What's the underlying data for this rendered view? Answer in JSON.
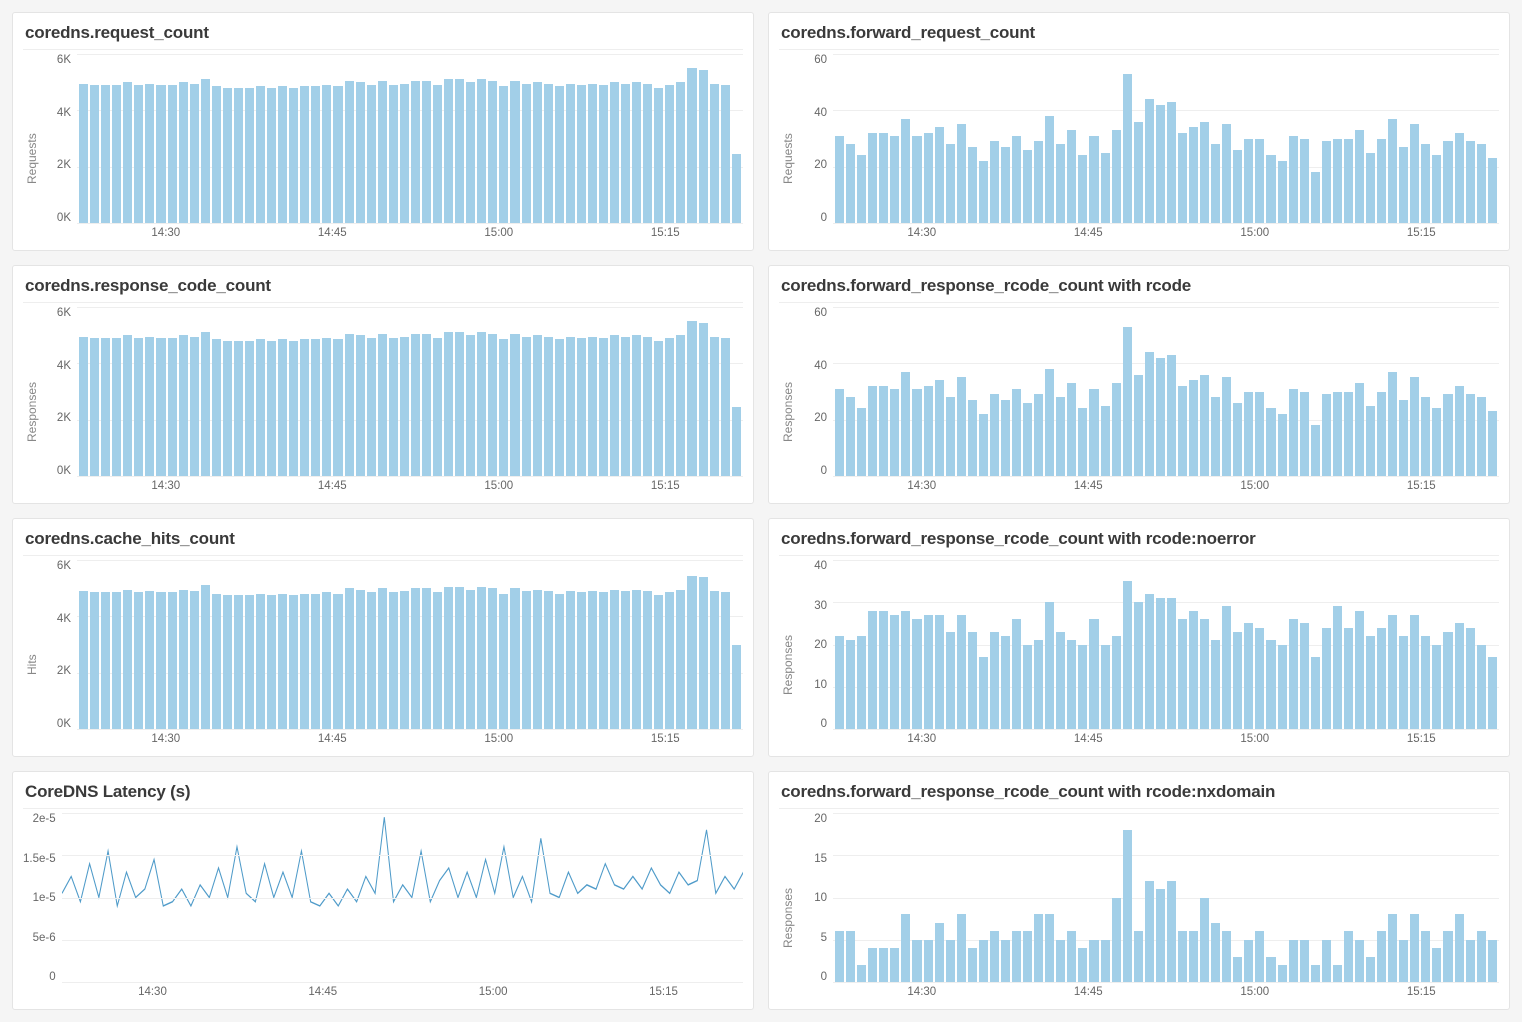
{
  "x_labels": [
    "14:30",
    "14:45",
    "15:00",
    "15:15"
  ],
  "panels": [
    {
      "id": "request_count",
      "title": "coredns.request_count",
      "ylabel": "Requests",
      "type": "bar",
      "ymax": 6000,
      "yticks": [
        "6K",
        "4K",
        "2K",
        "0K"
      ],
      "values": [
        4950,
        4900,
        4900,
        4900,
        5000,
        4900,
        4950,
        4900,
        4900,
        5000,
        4950,
        5100,
        4850,
        4800,
        4800,
        4800,
        4850,
        4800,
        4850,
        4800,
        4850,
        4850,
        4900,
        4850,
        5050,
        5000,
        4900,
        5050,
        4900,
        4950,
        5050,
        5050,
        4900,
        5100,
        5100,
        5000,
        5100,
        5050,
        4850,
        5050,
        4950,
        5000,
        4950,
        4850,
        4950,
        4900,
        4950,
        4900,
        5000,
        4950,
        5000,
        4950,
        4800,
        4900,
        5000,
        5500,
        5450,
        4950,
        4900,
        2450
      ]
    },
    {
      "id": "forward_request_count",
      "title": "coredns.forward_request_count",
      "ylabel": "Requests",
      "type": "bar",
      "ymax": 60,
      "yticks": [
        "60",
        "40",
        "20",
        "0"
      ],
      "values": [
        31,
        28,
        24,
        32,
        32,
        31,
        37,
        31,
        32,
        34,
        28,
        35,
        27,
        22,
        29,
        27,
        31,
        26,
        29,
        38,
        28,
        33,
        24,
        31,
        25,
        33,
        53,
        36,
        44,
        42,
        43,
        32,
        34,
        36,
        28,
        35,
        26,
        30,
        30,
        24,
        22,
        31,
        30,
        18,
        29,
        30,
        30,
        33,
        25,
        30,
        37,
        27,
        35,
        28,
        24,
        29,
        32,
        29,
        28,
        23
      ]
    },
    {
      "id": "response_code_count",
      "title": "coredns.response_code_count",
      "ylabel": "Responses",
      "type": "bar",
      "ymax": 6000,
      "yticks": [
        "6K",
        "4K",
        "2K",
        "0K"
      ],
      "values": [
        4950,
        4900,
        4900,
        4900,
        5000,
        4900,
        4950,
        4900,
        4900,
        5000,
        4950,
        5100,
        4850,
        4800,
        4800,
        4800,
        4850,
        4800,
        4850,
        4800,
        4850,
        4850,
        4900,
        4850,
        5050,
        5000,
        4900,
        5050,
        4900,
        4950,
        5050,
        5050,
        4900,
        5100,
        5100,
        5000,
        5100,
        5050,
        4850,
        5050,
        4950,
        5000,
        4950,
        4850,
        4950,
        4900,
        4950,
        4900,
        5000,
        4950,
        5000,
        4950,
        4800,
        4900,
        5000,
        5500,
        5450,
        4950,
        4900,
        2450
      ]
    },
    {
      "id": "forward_response_rcode",
      "title": "coredns.forward_response_rcode_count with rcode",
      "ylabel": "Responses",
      "type": "bar",
      "ymax": 60,
      "yticks": [
        "60",
        "40",
        "20",
        "0"
      ],
      "values": [
        31,
        28,
        24,
        32,
        32,
        31,
        37,
        31,
        32,
        34,
        28,
        35,
        27,
        22,
        29,
        27,
        31,
        26,
        29,
        38,
        28,
        33,
        24,
        31,
        25,
        33,
        53,
        36,
        44,
        42,
        43,
        32,
        34,
        36,
        28,
        35,
        26,
        30,
        30,
        24,
        22,
        31,
        30,
        18,
        29,
        30,
        30,
        33,
        25,
        30,
        37,
        27,
        35,
        28,
        24,
        29,
        32,
        29,
        28,
        23
      ]
    },
    {
      "id": "cache_hits_count",
      "title": "coredns.cache_hits_count",
      "ylabel": "Hits",
      "type": "bar",
      "ymax": 6000,
      "yticks": [
        "6K",
        "4K",
        "2K",
        "0K"
      ],
      "values": [
        4900,
        4850,
        4850,
        4850,
        4950,
        4850,
        4900,
        4850,
        4850,
        4950,
        4900,
        5100,
        4800,
        4750,
        4750,
        4750,
        4800,
        4750,
        4800,
        4750,
        4800,
        4800,
        4850,
        4800,
        5000,
        4950,
        4850,
        5000,
        4850,
        4900,
        5000,
        5000,
        4850,
        5050,
        5050,
        4950,
        5050,
        5000,
        4800,
        5000,
        4900,
        4950,
        4900,
        4800,
        4900,
        4850,
        4900,
        4850,
        4950,
        4900,
        4950,
        4900,
        4750,
        4850,
        4950,
        5450,
        5400,
        4900,
        4850,
        3000
      ]
    },
    {
      "id": "forward_response_noerror",
      "title": "coredns.forward_response_rcode_count with rcode:noerror",
      "ylabel": "Responses",
      "type": "bar",
      "ymax": 40,
      "yticks": [
        "40",
        "30",
        "20",
        "10",
        "0"
      ],
      "values": [
        22,
        21,
        22,
        28,
        28,
        27,
        28,
        26,
        27,
        27,
        23,
        27,
        23,
        17,
        23,
        22,
        26,
        20,
        21,
        30,
        23,
        21,
        20,
        26,
        20,
        22,
        35,
        30,
        32,
        31,
        31,
        26,
        28,
        26,
        21,
        29,
        23,
        25,
        24,
        21,
        20,
        26,
        25,
        17,
        24,
        29,
        24,
        28,
        22,
        24,
        27,
        22,
        27,
        22,
        20,
        23,
        25,
        24,
        20,
        17
      ]
    },
    {
      "id": "latency",
      "title": "CoreDNS Latency (s)",
      "ylabel": "",
      "type": "line",
      "ymax": 2e-05,
      "yticks": [
        "2e-5",
        "1.5e-5",
        "1e-5",
        "5e-6",
        "0"
      ],
      "values": [
        1.05e-05,
        1.25e-05,
        9.5e-06,
        1.4e-05,
        1e-05,
        1.55e-05,
        9e-06,
        1.3e-05,
        1e-05,
        1.1e-05,
        1.45e-05,
        9e-06,
        9.5e-06,
        1.1e-05,
        9e-06,
        1.15e-05,
        1e-05,
        1.35e-05,
        1e-05,
        1.6e-05,
        1.05e-05,
        9.5e-06,
        1.4e-05,
        1e-05,
        1.3e-05,
        1e-05,
        1.55e-05,
        9.5e-06,
        9e-06,
        1.05e-05,
        9e-06,
        1.1e-05,
        9.5e-06,
        1.25e-05,
        1.05e-05,
        1.95e-05,
        9.5e-06,
        1.15e-05,
        1e-05,
        1.55e-05,
        9.5e-06,
        1.2e-05,
        1.35e-05,
        1e-05,
        1.3e-05,
        1e-05,
        1.45e-05,
        1.05e-05,
        1.6e-05,
        1e-05,
        1.25e-05,
        9.5e-06,
        1.7e-05,
        1.05e-05,
        1e-05,
        1.3e-05,
        1.05e-05,
        1.15e-05,
        1.1e-05,
        1.4e-05,
        1.15e-05,
        1.1e-05,
        1.25e-05,
        1.1e-05,
        1.35e-05,
        1.15e-05,
        1.05e-05,
        1.3e-05,
        1.15e-05,
        1.2e-05,
        1.8e-05,
        1.05e-05,
        1.25e-05,
        1.1e-05,
        1.3e-05
      ]
    },
    {
      "id": "forward_response_nxdomain",
      "title": "coredns.forward_response_rcode_count with rcode:nxdomain",
      "ylabel": "Responses",
      "type": "bar",
      "ymax": 20,
      "yticks": [
        "20",
        "15",
        "10",
        "5",
        "0"
      ],
      "values": [
        6,
        6,
        2,
        4,
        4,
        4,
        8,
        5,
        5,
        7,
        5,
        8,
        4,
        5,
        6,
        5,
        6,
        6,
        8,
        8,
        5,
        6,
        4,
        5,
        5,
        10,
        18,
        6,
        12,
        11,
        12,
        6,
        6,
        10,
        7,
        6,
        3,
        5,
        6,
        3,
        2,
        5,
        5,
        2,
        5,
        2,
        6,
        5,
        3,
        6,
        8,
        5,
        8,
        6,
        4,
        6,
        8,
        5,
        6,
        5
      ]
    }
  ],
  "chart_data": [
    {
      "title": "coredns.request_count",
      "type": "bar",
      "ylabel": "Requests",
      "x_range": [
        "14:22",
        "15:22"
      ],
      "yticks": [
        0,
        2000,
        4000,
        6000
      ],
      "values": [
        4950,
        4900,
        4900,
        4900,
        5000,
        4900,
        4950,
        4900,
        4900,
        5000,
        4950,
        5100,
        4850,
        4800,
        4800,
        4800,
        4850,
        4800,
        4850,
        4800,
        4850,
        4850,
        4900,
        4850,
        5050,
        5000,
        4900,
        5050,
        4900,
        4950,
        5050,
        5050,
        4900,
        5100,
        5100,
        5000,
        5100,
        5050,
        4850,
        5050,
        4950,
        5000,
        4950,
        4850,
        4950,
        4900,
        4950,
        4900,
        5000,
        4950,
        5000,
        4950,
        4800,
        4900,
        5000,
        5500,
        5450,
        4950,
        4900,
        2450
      ]
    },
    {
      "title": "coredns.forward_request_count",
      "type": "bar",
      "ylabel": "Requests",
      "x_range": [
        "14:22",
        "15:22"
      ],
      "yticks": [
        0,
        20,
        40,
        60
      ],
      "values": [
        31,
        28,
        24,
        32,
        32,
        31,
        37,
        31,
        32,
        34,
        28,
        35,
        27,
        22,
        29,
        27,
        31,
        26,
        29,
        38,
        28,
        33,
        24,
        31,
        25,
        33,
        53,
        36,
        44,
        42,
        43,
        32,
        34,
        36,
        28,
        35,
        26,
        30,
        30,
        24,
        22,
        31,
        30,
        18,
        29,
        30,
        30,
        33,
        25,
        30,
        37,
        27,
        35,
        28,
        24,
        29,
        32,
        29,
        28,
        23
      ]
    },
    {
      "title": "coredns.response_code_count",
      "type": "bar",
      "ylabel": "Responses",
      "x_range": [
        "14:22",
        "15:22"
      ],
      "yticks": [
        0,
        2000,
        4000,
        6000
      ],
      "values": [
        4950,
        4900,
        4900,
        4900,
        5000,
        4900,
        4950,
        4900,
        4900,
        5000,
        4950,
        5100,
        4850,
        4800,
        4800,
        4800,
        4850,
        4800,
        4850,
        4800,
        4850,
        4850,
        4900,
        4850,
        5050,
        5000,
        4900,
        5050,
        4900,
        4950,
        5050,
        5050,
        4900,
        5100,
        5100,
        5000,
        5100,
        5050,
        4850,
        5050,
        4950,
        5000,
        4950,
        4850,
        4950,
        4900,
        4950,
        4900,
        5000,
        4950,
        5000,
        4950,
        4800,
        4900,
        5000,
        5500,
        5450,
        4950,
        4900,
        2450
      ]
    },
    {
      "title": "coredns.forward_response_rcode_count with rcode",
      "type": "bar",
      "ylabel": "Responses",
      "x_range": [
        "14:22",
        "15:22"
      ],
      "yticks": [
        0,
        20,
        40,
        60
      ],
      "values": [
        31,
        28,
        24,
        32,
        32,
        31,
        37,
        31,
        32,
        34,
        28,
        35,
        27,
        22,
        29,
        27,
        31,
        26,
        29,
        38,
        28,
        33,
        24,
        31,
        25,
        33,
        53,
        36,
        44,
        42,
        43,
        32,
        34,
        36,
        28,
        35,
        26,
        30,
        30,
        24,
        22,
        31,
        30,
        18,
        29,
        30,
        30,
        33,
        25,
        30,
        37,
        27,
        35,
        28,
        24,
        29,
        32,
        29,
        28,
        23
      ]
    },
    {
      "title": "coredns.cache_hits_count",
      "type": "bar",
      "ylabel": "Hits",
      "x_range": [
        "14:22",
        "15:22"
      ],
      "yticks": [
        0,
        2000,
        4000,
        6000
      ],
      "values": [
        4900,
        4850,
        4850,
        4850,
        4950,
        4850,
        4900,
        4850,
        4850,
        4950,
        4900,
        5100,
        4800,
        4750,
        4750,
        4750,
        4800,
        4750,
        4800,
        4750,
        4800,
        4800,
        4850,
        4800,
        5000,
        4950,
        4850,
        5000,
        4850,
        4900,
        5000,
        5000,
        4850,
        5050,
        5050,
        4950,
        5050,
        5000,
        4800,
        5000,
        4900,
        4950,
        4900,
        4800,
        4900,
        4850,
        4900,
        4850,
        4950,
        4900,
        4950,
        4900,
        4750,
        4850,
        4950,
        5450,
        5400,
        4900,
        4850,
        3000
      ]
    },
    {
      "title": "coredns.forward_response_rcode_count with rcode:noerror",
      "type": "bar",
      "ylabel": "Responses",
      "x_range": [
        "14:22",
        "15:22"
      ],
      "yticks": [
        0,
        10,
        20,
        30,
        40
      ],
      "values": [
        22,
        21,
        22,
        28,
        28,
        27,
        28,
        26,
        27,
        27,
        23,
        27,
        23,
        17,
        23,
        22,
        26,
        20,
        21,
        30,
        23,
        21,
        20,
        26,
        20,
        22,
        35,
        30,
        32,
        31,
        31,
        26,
        28,
        26,
        21,
        29,
        23,
        25,
        24,
        21,
        20,
        26,
        25,
        17,
        24,
        29,
        24,
        28,
        22,
        24,
        27,
        22,
        27,
        22,
        20,
        23,
        25,
        24,
        20,
        17
      ]
    },
    {
      "title": "CoreDNS Latency (s)",
      "type": "line",
      "ylabel": "",
      "x_range": [
        "14:22",
        "15:22"
      ],
      "yticks": [
        0,
        5e-06,
        1e-05,
        1.5e-05,
        2e-05
      ],
      "values": [
        1.05e-05,
        1.25e-05,
        9.5e-06,
        1.4e-05,
        1e-05,
        1.55e-05,
        9e-06,
        1.3e-05,
        1e-05,
        1.1e-05,
        1.45e-05,
        9e-06,
        9.5e-06,
        1.1e-05,
        9e-06,
        1.15e-05,
        1e-05,
        1.35e-05,
        1e-05,
        1.6e-05,
        1.05e-05,
        9.5e-06,
        1.4e-05,
        1e-05,
        1.3e-05,
        1e-05,
        1.55e-05,
        9.5e-06,
        9e-06,
        1.05e-05,
        9e-06,
        1.1e-05,
        9.5e-06,
        1.25e-05,
        1.05e-05,
        1.95e-05,
        9.5e-06,
        1.15e-05,
        1e-05,
        1.55e-05,
        9.5e-06,
        1.2e-05,
        1.35e-05,
        1e-05,
        1.3e-05,
        1e-05,
        1.45e-05,
        1.05e-05,
        1.6e-05,
        1e-05,
        1.25e-05,
        9.5e-06,
        1.7e-05,
        1.05e-05,
        1e-05,
        1.3e-05,
        1.05e-05,
        1.15e-05,
        1.1e-05,
        1.4e-05,
        1.15e-05,
        1.1e-05,
        1.25e-05,
        1.1e-05,
        1.35e-05,
        1.15e-05,
        1.05e-05,
        1.3e-05,
        1.15e-05,
        1.2e-05,
        1.8e-05,
        1.05e-05,
        1.25e-05,
        1.1e-05,
        1.3e-05
      ]
    },
    {
      "title": "coredns.forward_response_rcode_count with rcode:nxdomain",
      "type": "bar",
      "ylabel": "Responses",
      "x_range": [
        "14:22",
        "15:22"
      ],
      "yticks": [
        0,
        5,
        10,
        15,
        20
      ],
      "values": [
        6,
        6,
        2,
        4,
        4,
        4,
        8,
        5,
        5,
        7,
        5,
        8,
        4,
        5,
        6,
        5,
        6,
        6,
        8,
        8,
        5,
        6,
        4,
        5,
        5,
        10,
        18,
        6,
        12,
        11,
        12,
        6,
        6,
        10,
        7,
        6,
        3,
        5,
        6,
        3,
        2,
        5,
        5,
        2,
        5,
        2,
        6,
        5,
        3,
        6,
        8,
        5,
        8,
        6,
        4,
        6,
        8,
        5,
        6,
        5
      ]
    }
  ]
}
